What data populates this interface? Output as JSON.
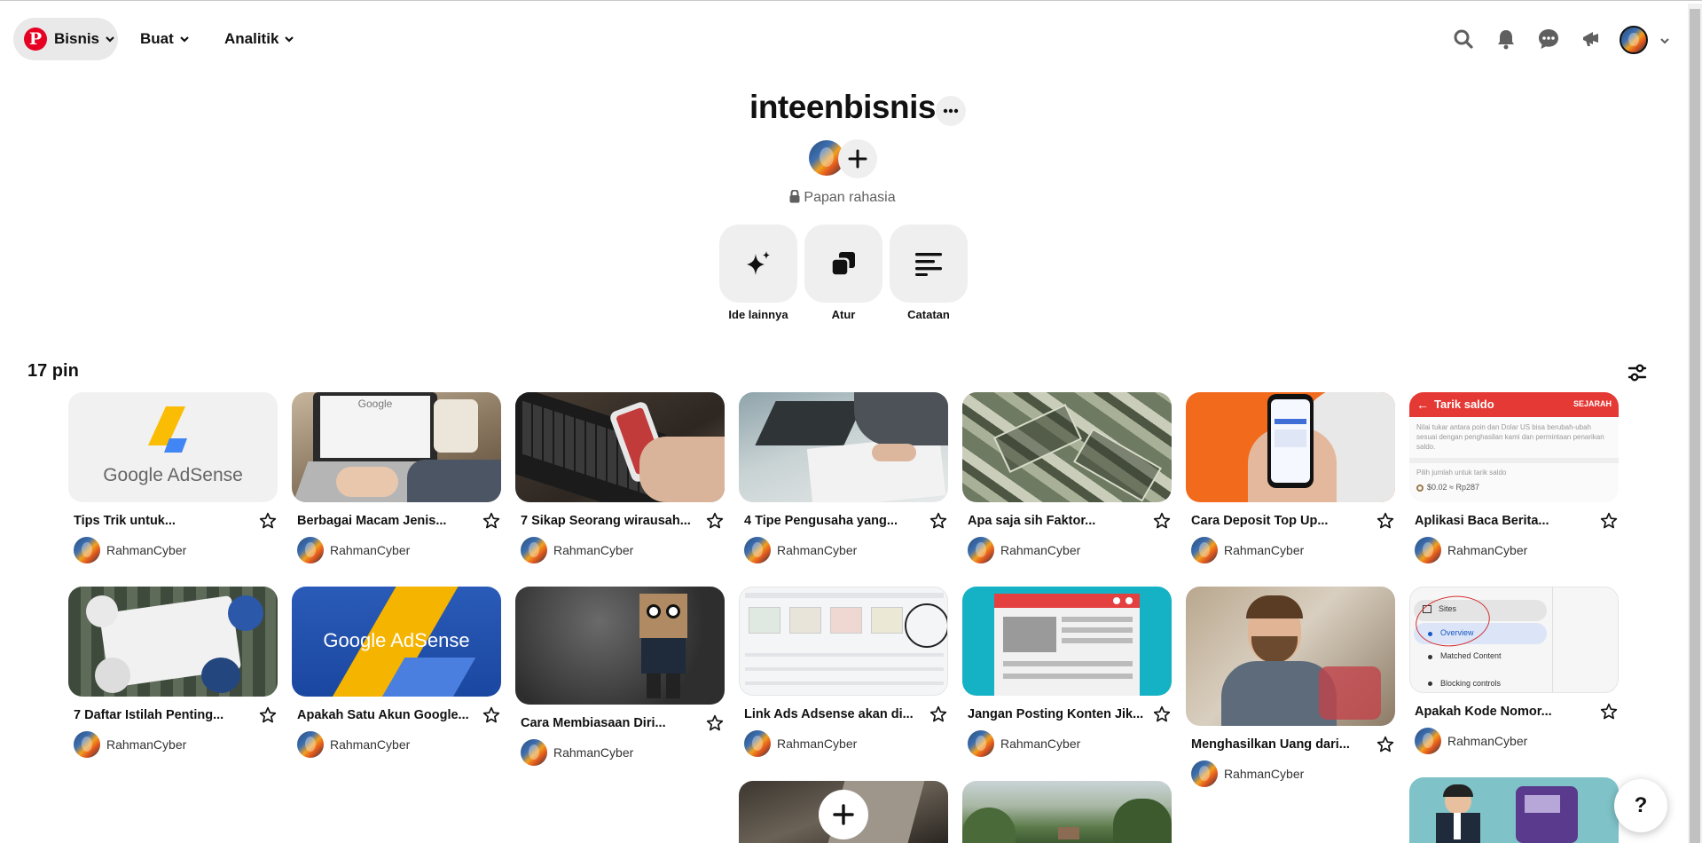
{
  "header": {
    "business_label": "Bisnis",
    "create_label": "Buat",
    "analytics_label": "Analitik"
  },
  "board": {
    "title": "inteenbisnis",
    "privacy_label": "Papan rahasia"
  },
  "actions": [
    {
      "label": "Ide lainnya",
      "icon": "sparkle-icon"
    },
    {
      "label": "Atur",
      "icon": "organize-icon"
    },
    {
      "label": "Catatan",
      "icon": "notes-icon"
    }
  ],
  "pin_count_label": "17 pin",
  "pins": [
    {
      "title": "Tips Trik untuk...",
      "author": "RahmanCyber"
    },
    {
      "title": "Berbagai Macam Jenis...",
      "author": "RahmanCyber"
    },
    {
      "title": "7 Sikap Seorang wirausah...",
      "author": "RahmanCyber"
    },
    {
      "title": "4 Tipe Pengusaha yang...",
      "author": "RahmanCyber"
    },
    {
      "title": "Apa saja sih Faktor...",
      "author": "RahmanCyber"
    },
    {
      "title": "Cara Deposit Top Up...",
      "author": "RahmanCyber"
    },
    {
      "title": "Aplikasi Baca Berita...",
      "author": "RahmanCyber"
    },
    {
      "title": "7 Daftar Istilah Penting...",
      "author": "RahmanCyber"
    },
    {
      "title": "Apakah Satu Akun Google...",
      "author": "RahmanCyber"
    },
    {
      "title": "Cara Membiasaan Diri...",
      "author": "RahmanCyber"
    },
    {
      "title": "Link Ads Adsense akan di...",
      "author": "RahmanCyber"
    },
    {
      "title": "Jangan Posting Konten Jik...",
      "author": "RahmanCyber"
    },
    {
      "title": "Menghasilkan Uang dari...",
      "author": "RahmanCyber"
    },
    {
      "title": "Apakah Kode Nomor...",
      "author": "RahmanCyber"
    }
  ],
  "pin_images": {
    "adsense_logo_text": "Google AdSense",
    "adsense_banner_text": "Google AdSense",
    "google_screen_text": "Google",
    "withdraw_title": "Tarik saldo",
    "withdraw_history": "SEJARAH",
    "withdraw_body": "Nilai tukar antara poin dan Dolar US bisa berubah-ubah sesuai dengan penghasilan kami dan permintaan penarikan saldo.",
    "withdraw_pick": "Pilih jumlah untuk tarik saldo",
    "withdraw_option": "$0.02 ≈ Rp287",
    "sites_menu": [
      "Sites",
      "Overview",
      "Matched Content",
      "Blocking controls"
    ]
  },
  "help_label": "?",
  "colors": {
    "brand": "#e60023",
    "pill_bg": "#e9e9e9",
    "tile_bg": "#efefef"
  }
}
